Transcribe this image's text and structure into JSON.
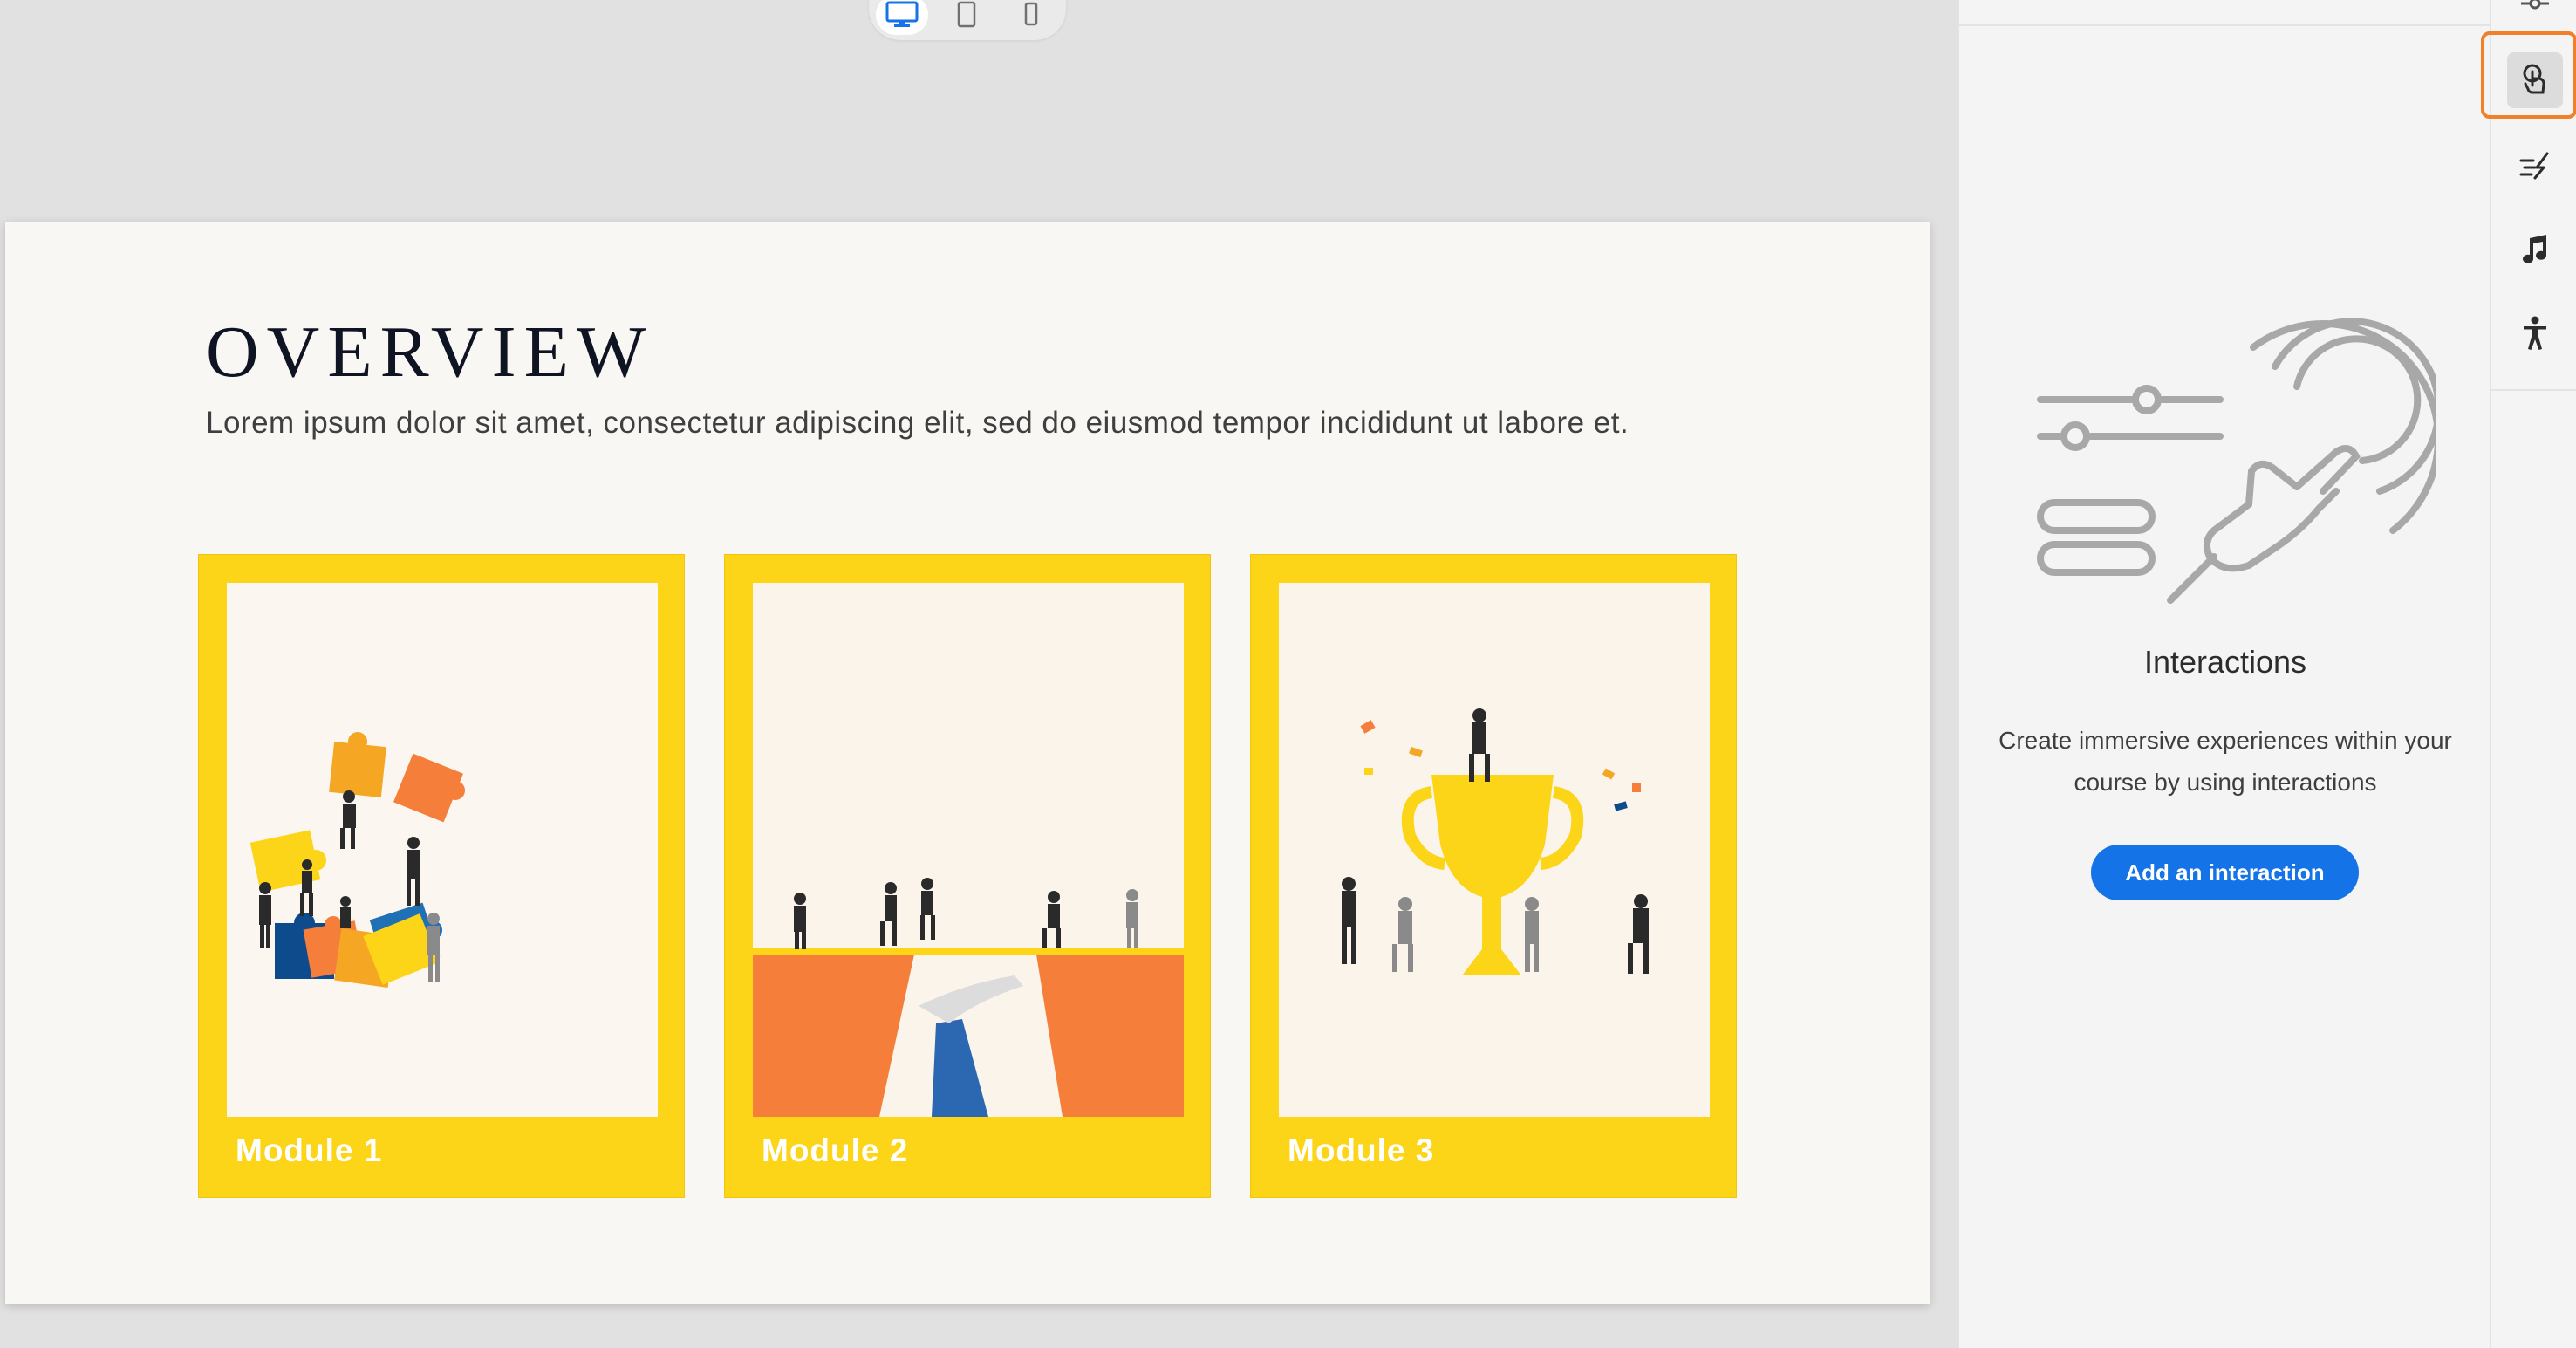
{
  "device_toggle": {
    "desktop": "desktop-icon",
    "tablet": "tablet-icon",
    "phone": "phone-icon",
    "active": "desktop"
  },
  "slide": {
    "title": "OVERVIEW",
    "subtitle": "Lorem ipsum dolor sit amet, consectetur adipiscing elit, sed do eiusmod tempor incididunt ut labore et.",
    "cards": [
      {
        "label": "Module 1",
        "image": "puzzle-team-illustration"
      },
      {
        "label": "Module 2",
        "image": "bridge-gap-illustration"
      },
      {
        "label": "Module 3",
        "image": "trophy-celebration-illustration"
      }
    ]
  },
  "panel": {
    "heading": "Interactions",
    "description": "Create immersive experiences within your course by using interactions",
    "button_label": "Add an interaction",
    "illustration": "touch-interaction-illustration"
  },
  "rail": {
    "items": [
      {
        "icon": "touch-icon",
        "active": true
      },
      {
        "icon": "effects-icon",
        "active": false
      },
      {
        "icon": "music-note-icon",
        "active": false
      },
      {
        "icon": "accessibility-icon",
        "active": false
      }
    ]
  },
  "colors": {
    "card_yellow": "#fcd519",
    "accent_blue": "#1473e6",
    "highlight_orange": "#f0802a",
    "orange": "#f47e3a",
    "navy": "#0c4a8a"
  }
}
